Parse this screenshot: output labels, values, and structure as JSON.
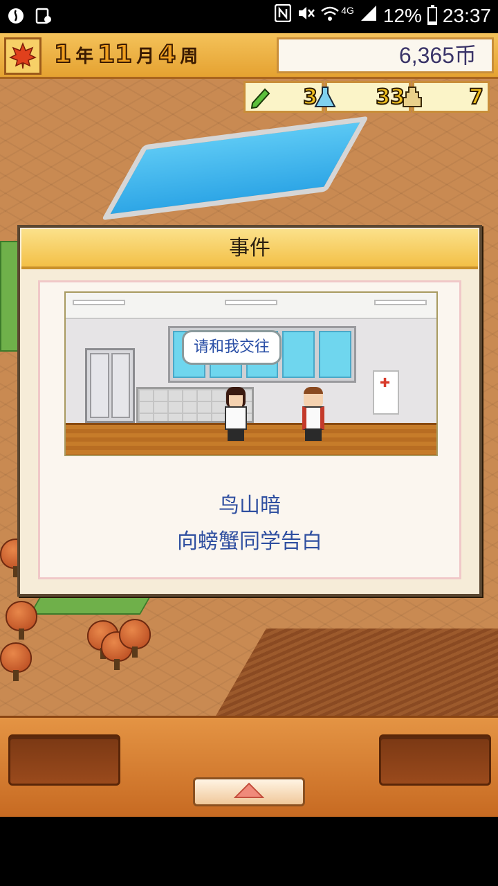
{
  "status_bar": {
    "network": "4G",
    "battery": "12%",
    "time": "23:37",
    "icons": [
      "app-notification-icon",
      "media-notification-icon",
      "nfc-icon",
      "mute-icon",
      "wifi-icon",
      "signal-icon",
      "battery-icon"
    ]
  },
  "hud": {
    "season_icon": "maple-leaf-icon",
    "year": "1",
    "year_unit": "年",
    "month": "11",
    "month_unit": "月",
    "week": "4",
    "week_unit": "周",
    "money": "6,365币",
    "resources": [
      {
        "icon": "pencil-icon",
        "value": "3"
      },
      {
        "icon": "flask-icon",
        "value": "33"
      },
      {
        "icon": "trophy-icon",
        "value": "7"
      }
    ]
  },
  "event_dialog": {
    "title": "事件",
    "speech_bubble": "请和我交往",
    "student_name": "鸟山暗",
    "description": "向螃蟹同学告白"
  },
  "bottom_bar": {
    "menu_icon": "triangle-up-icon"
  },
  "colors": {
    "hud_gold": "#f0a020",
    "money_text": "#3a3468",
    "event_text": "#2f4fa0",
    "bar_orange": "#d97a2e"
  }
}
